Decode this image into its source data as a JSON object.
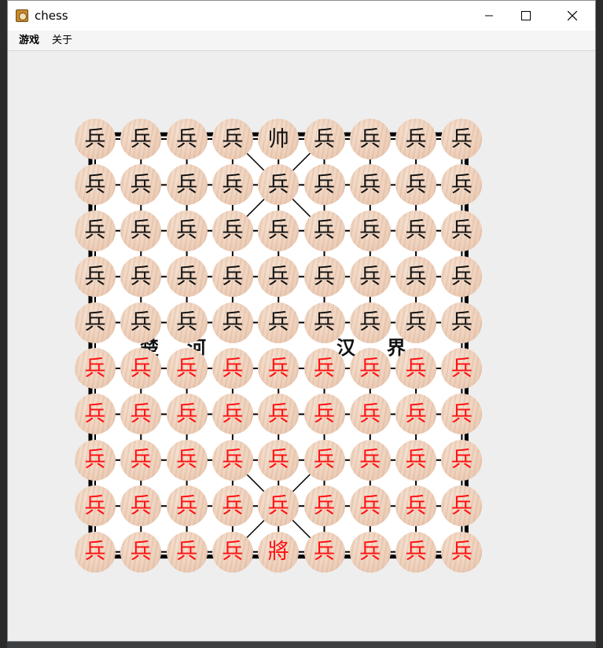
{
  "window": {
    "title": "chess",
    "minimize_glyph": "—",
    "maximize_glyph": "☐",
    "close_glyph": "✕"
  },
  "menu": [
    {
      "label": "游戏"
    },
    {
      "label": "关于"
    }
  ],
  "board": {
    "columns": 9,
    "rows": 10,
    "river_left": [
      "楚",
      "河"
    ],
    "river_right": [
      "汉",
      "界"
    ],
    "colors": {
      "black_piece_text": "#111111",
      "red_piece_text": "#ff1010",
      "line": "#000000"
    },
    "pieces": [
      [
        "兵",
        "兵",
        "兵",
        "兵",
        "帅",
        "兵",
        "兵",
        "兵",
        "兵"
      ],
      [
        "兵",
        "兵",
        "兵",
        "兵",
        "兵",
        "兵",
        "兵",
        "兵",
        "兵"
      ],
      [
        "兵",
        "兵",
        "兵",
        "兵",
        "兵",
        "兵",
        "兵",
        "兵",
        "兵"
      ],
      [
        "兵",
        "兵",
        "兵",
        "兵",
        "兵",
        "兵",
        "兵",
        "兵",
        "兵"
      ],
      [
        "兵",
        "兵",
        "兵",
        "兵",
        "兵",
        "兵",
        "兵",
        "兵",
        "兵"
      ],
      [
        "兵",
        "兵",
        "兵",
        "兵",
        "兵",
        "兵",
        "兵",
        "兵",
        "兵"
      ],
      [
        "兵",
        "兵",
        "兵",
        "兵",
        "兵",
        "兵",
        "兵",
        "兵",
        "兵"
      ],
      [
        "兵",
        "兵",
        "兵",
        "兵",
        "兵",
        "兵",
        "兵",
        "兵",
        "兵"
      ],
      [
        "兵",
        "兵",
        "兵",
        "兵",
        "兵",
        "兵",
        "兵",
        "兵",
        "兵"
      ],
      [
        "兵",
        "兵",
        "兵",
        "兵",
        "將",
        "兵",
        "兵",
        "兵",
        "兵"
      ]
    ],
    "piece_sides": [
      "black",
      "black",
      "black",
      "black",
      "black",
      "red",
      "red",
      "red",
      "red",
      "red"
    ]
  }
}
